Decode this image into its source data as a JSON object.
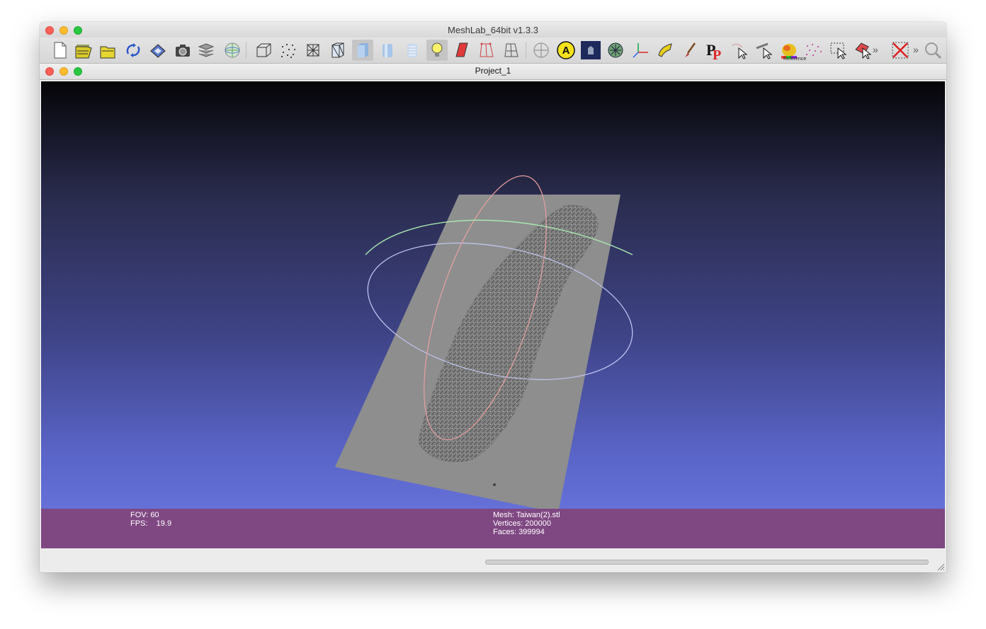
{
  "window": {
    "title": "MeshLab_64bit v1.3.3"
  },
  "toolbar": {
    "items": [
      {
        "name": "new-project-icon"
      },
      {
        "name": "open-project-icon"
      },
      {
        "name": "import-mesh-icon"
      },
      {
        "name": "reload-icon"
      },
      {
        "name": "save-icon"
      },
      {
        "name": "snapshot-icon"
      },
      {
        "name": "layers-icon"
      },
      {
        "name": "raster-icon"
      },
      {
        "name": "bounding-box-icon"
      },
      {
        "name": "points-icon"
      },
      {
        "name": "wireframe-icon"
      },
      {
        "name": "hidden-lines-icon"
      },
      {
        "name": "flat-shading-icon"
      },
      {
        "name": "smooth-shading-icon"
      },
      {
        "name": "texture-icon"
      },
      {
        "name": "light-icon"
      },
      {
        "name": "double-side-lighting-icon"
      },
      {
        "name": "fancy-lighting-icon"
      },
      {
        "name": "trackball-icon"
      },
      {
        "name": "annotation-icon"
      },
      {
        "name": "decorate-background-icon"
      },
      {
        "name": "normals-icon"
      },
      {
        "name": "axes-icon"
      },
      {
        "name": "align-icon"
      },
      {
        "name": "paint-icon"
      },
      {
        "name": "pick-points-icon"
      },
      {
        "name": "select-vertices-icon"
      },
      {
        "name": "measure-icon"
      },
      {
        "name": "color-mesh-icon"
      },
      {
        "name": "reference-icon"
      },
      {
        "name": "select-faces-icon"
      },
      {
        "name": "select-connected-icon"
      },
      {
        "name": "delete-icon"
      },
      {
        "name": "search-icon"
      }
    ],
    "reference_label": "Reference",
    "overflow_label": "»"
  },
  "project": {
    "title": "Project_1"
  },
  "viewport": {
    "fov_line": "FOV: 60",
    "fps_line": "FPS:    19.9",
    "mesh_line": "Mesh: Taiwan(2).stl",
    "vertices_line": "Vertices: 200000",
    "faces_line": "Faces: 399994"
  },
  "colors": {
    "info_band": "#7f4882",
    "mesh": "#8e8e8e",
    "trackball_red": "#e8a0a0",
    "trackball_green": "#a8e8b0",
    "trackball_blue": "#b0b4ee"
  }
}
